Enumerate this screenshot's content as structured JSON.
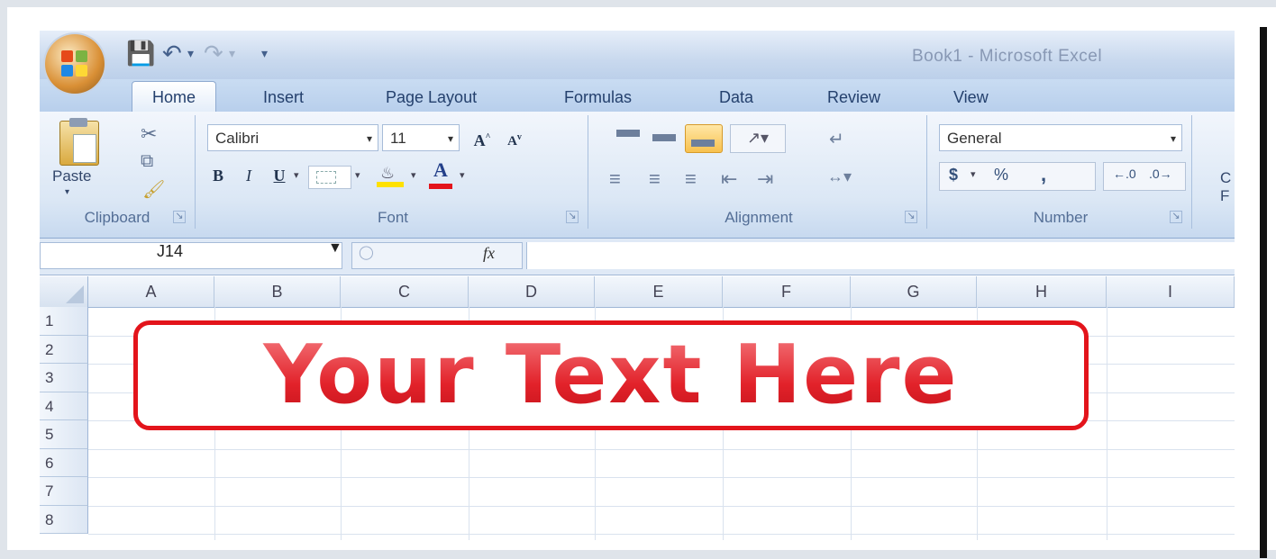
{
  "window": {
    "title": "Book1 - Microsoft Excel"
  },
  "tabs": [
    {
      "label": "Home"
    },
    {
      "label": "Insert"
    },
    {
      "label": "Page Layout"
    },
    {
      "label": "Formulas"
    },
    {
      "label": "Data"
    },
    {
      "label": "Review"
    },
    {
      "label": "View"
    }
  ],
  "ribbon": {
    "clipboard": {
      "paste_label": "Paste",
      "group_label": "Clipboard"
    },
    "font": {
      "font_name": "Calibri",
      "font_size": "11",
      "group_label": "Font",
      "grow_label": "A",
      "shrink_label": "A",
      "bold": "B",
      "italic": "I",
      "underline": "U",
      "font_color_label": "A"
    },
    "alignment": {
      "group_label": "Alignment"
    },
    "number": {
      "format": "General",
      "currency": "$",
      "percent": "%",
      "comma": ",",
      "group_label": "Number"
    },
    "cutoff": {
      "line1": "C",
      "line2": "F"
    }
  },
  "formula_bar": {
    "cell_ref": "J14",
    "fx": "fx",
    "value": ""
  },
  "grid": {
    "columns": [
      "A",
      "B",
      "C",
      "D",
      "E",
      "F",
      "G",
      "H",
      "I"
    ],
    "rows": [
      "1",
      "2",
      "3",
      "4",
      "5",
      "6",
      "7",
      "8"
    ]
  },
  "callout": {
    "text": "Your Text Here",
    "color": "#e3141b"
  },
  "colors": {
    "ribbon": "#dbe7f5",
    "accent": "#e3141b",
    "tab_text": "#24406d"
  }
}
